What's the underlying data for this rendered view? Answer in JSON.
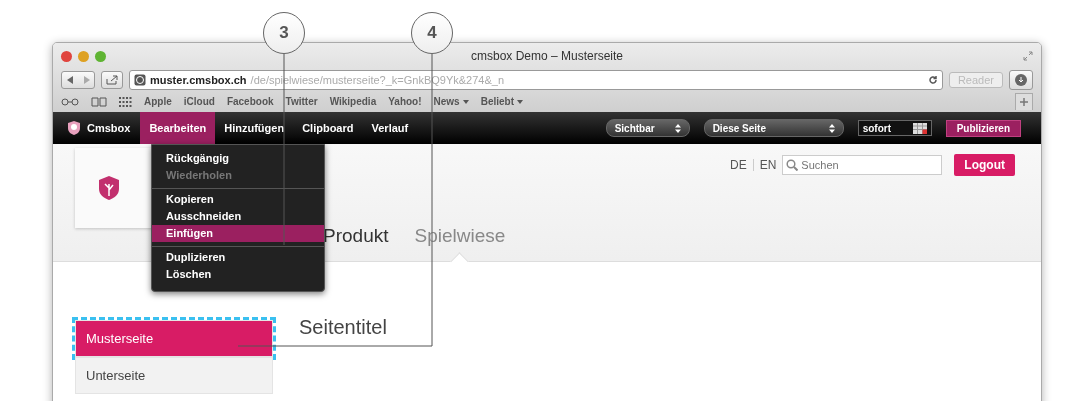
{
  "window": {
    "title": "cmsbox Demo – Musterseite"
  },
  "address_bar": {
    "host": "muster.cmsbox.ch",
    "path": "/de/spielwiese/musterseite?_k=GnkBQ9Yk&274&_n",
    "reader": "Reader"
  },
  "bookmarks": [
    {
      "label": "Apple",
      "has_menu": false
    },
    {
      "label": "iCloud",
      "has_menu": false
    },
    {
      "label": "Facebook",
      "has_menu": false
    },
    {
      "label": "Twitter",
      "has_menu": false
    },
    {
      "label": "Wikipedia",
      "has_menu": false
    },
    {
      "label": "Yahoo!",
      "has_menu": false
    },
    {
      "label": "News",
      "has_menu": true
    },
    {
      "label": "Beliebt",
      "has_menu": true
    }
  ],
  "cms_bar": {
    "brand": "Cmsbox",
    "menus": [
      {
        "label": "Bearbeiten",
        "selected": true
      },
      {
        "label": "Hinzufügen",
        "selected": false
      },
      {
        "label": "Clipboard",
        "selected": false
      },
      {
        "label": "Verlauf",
        "selected": false
      }
    ],
    "visibility": "Sichtbar",
    "scope": "Diese Seite",
    "date": "sofort",
    "publish": "Publizieren"
  },
  "edit_menu": [
    [
      {
        "label": "Rückgängig",
        "disabled": false,
        "selected": false
      },
      {
        "label": "Wiederholen",
        "disabled": true,
        "selected": false
      }
    ],
    [
      {
        "label": "Kopieren",
        "disabled": false,
        "selected": false
      },
      {
        "label": "Ausschneiden",
        "disabled": false,
        "selected": false
      },
      {
        "label": "Einfügen",
        "disabled": false,
        "selected": true
      }
    ],
    [
      {
        "label": "Duplizieren",
        "disabled": false,
        "selected": false
      },
      {
        "label": "Löschen",
        "disabled": false,
        "selected": false
      }
    ]
  ],
  "header": {
    "languages": [
      "DE",
      "EN"
    ],
    "search": {
      "placeholder": "Suchen"
    },
    "logout": "Logout"
  },
  "nav": [
    {
      "label": "Produkt",
      "selected": false
    },
    {
      "label": "Spielwiese",
      "selected": true
    }
  ],
  "sidebar": [
    {
      "label": "Musterseite",
      "selected": true
    },
    {
      "label": "Unterseite",
      "selected": false
    }
  ],
  "page_title": "Seitentitel",
  "callouts": [
    "3",
    "4"
  ]
}
